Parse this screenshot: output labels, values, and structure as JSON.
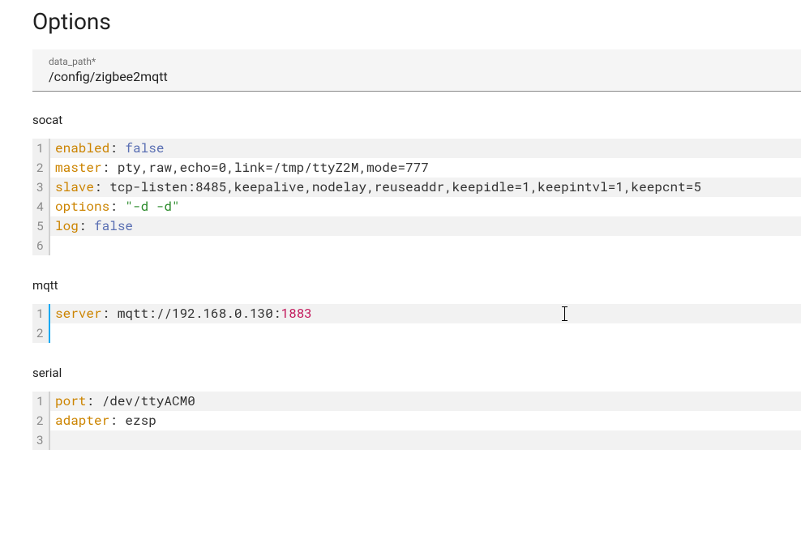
{
  "title": "Options",
  "data_path": {
    "label": "data_path*",
    "value": "/config/zigbee2mqtt"
  },
  "sections": {
    "socat": {
      "label": "socat",
      "lines": [
        {
          "key": "enabled",
          "type": "bool",
          "value": "false"
        },
        {
          "key": "master",
          "type": "plain",
          "value": "pty,raw,echo=0,link=/tmp/ttyZ2M,mode=777"
        },
        {
          "key": "slave",
          "type": "plain",
          "value": "tcp-listen:8485,keepalive,nodelay,reuseaddr,keepidle=1,keepintvl=1,keepcnt=5"
        },
        {
          "key": "options",
          "type": "string",
          "value": "\"-d -d\""
        },
        {
          "key": "log",
          "type": "bool",
          "value": "false"
        },
        {
          "key": "",
          "type": "empty",
          "value": ""
        }
      ]
    },
    "mqtt": {
      "label": "mqtt",
      "lines": [
        {
          "key": "server",
          "type": "url",
          "prefix": "mqtt://192.168.0.130:",
          "port": "1883"
        },
        {
          "key": "",
          "type": "empty",
          "value": ""
        }
      ]
    },
    "serial": {
      "label": "serial",
      "lines": [
        {
          "key": "port",
          "type": "plain",
          "value": "/dev/ttyACM0"
        },
        {
          "key": "adapter",
          "type": "plain",
          "value": "ezsp"
        },
        {
          "key": "",
          "type": "empty",
          "value": ""
        }
      ]
    }
  }
}
